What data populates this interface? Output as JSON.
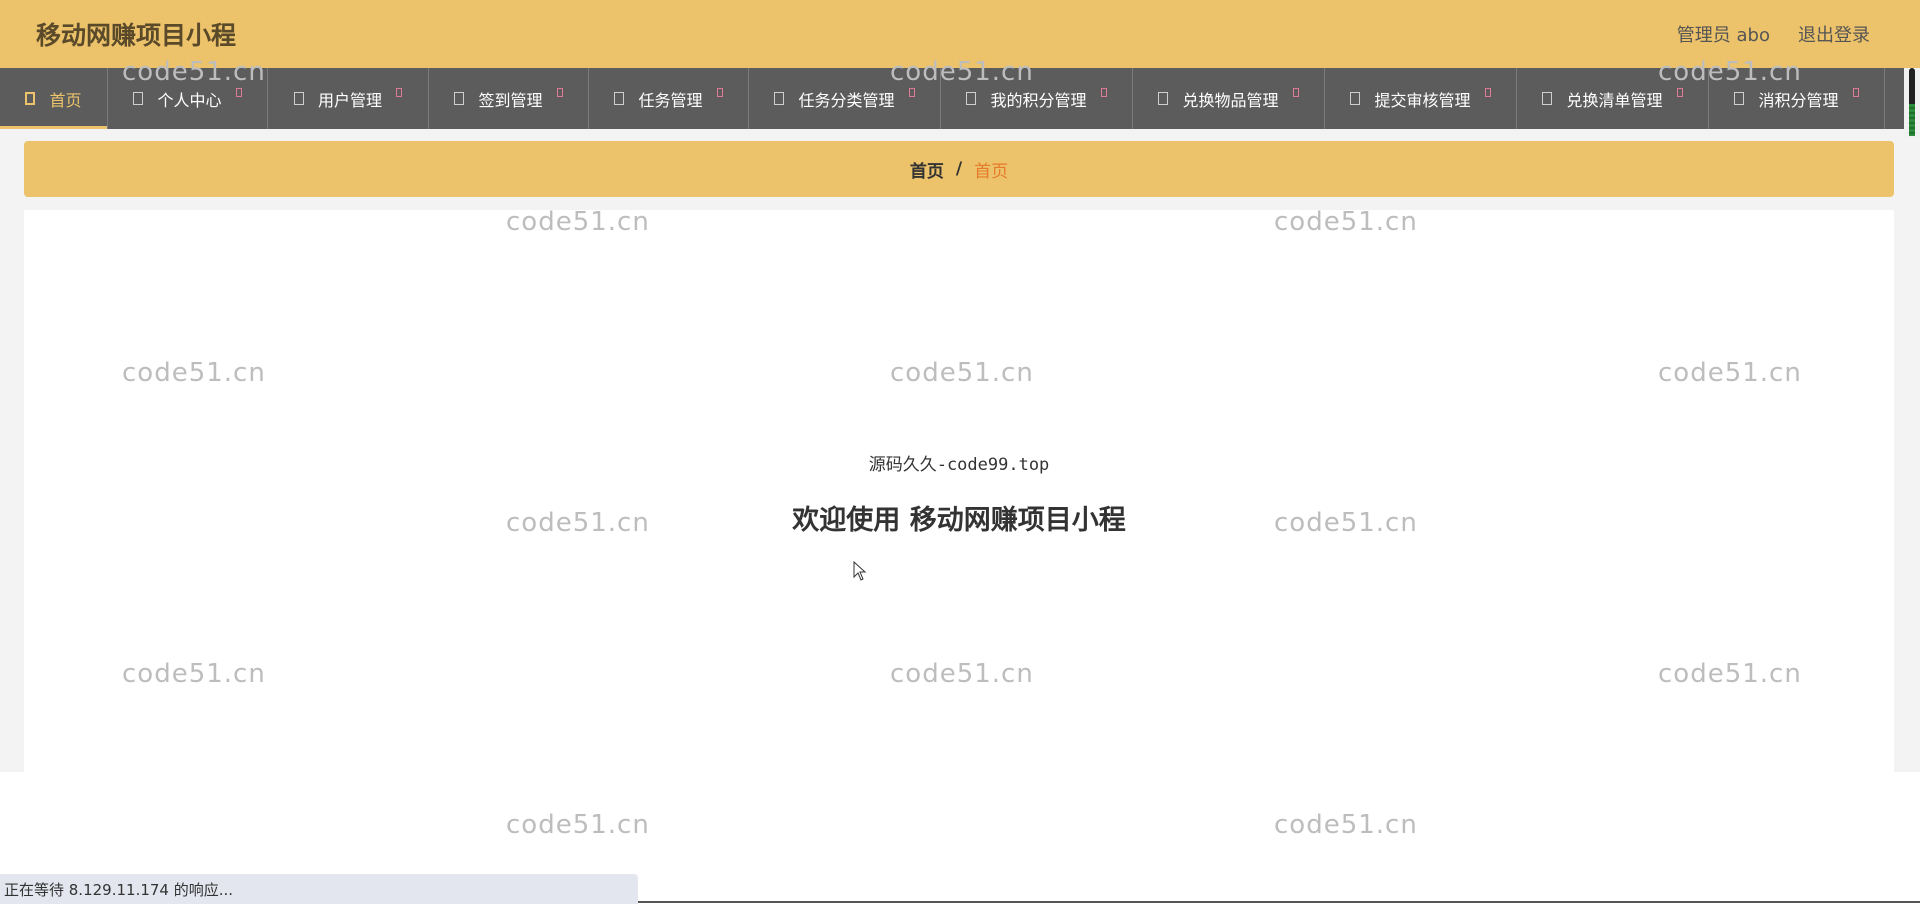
{
  "header": {
    "title": "移动网赚项目小程",
    "user_label": "管理员 abo",
    "logout_label": "退出登录"
  },
  "nav": {
    "items": [
      {
        "label": "首页",
        "active": true
      },
      {
        "label": "个人中心"
      },
      {
        "label": "用户管理"
      },
      {
        "label": "签到管理"
      },
      {
        "label": "任务管理"
      },
      {
        "label": "任务分类管理"
      },
      {
        "label": "我的积分管理"
      },
      {
        "label": "兑换物品管理"
      },
      {
        "label": "提交审核管理"
      },
      {
        "label": "兑换清单管理"
      },
      {
        "label": "消积分管理"
      }
    ]
  },
  "breadcrumb": {
    "home": "首页",
    "separator": "/",
    "current": "首页"
  },
  "content": {
    "subtitle": "源码久久-code99.top",
    "welcome": "欢迎使用 移动网赚项目小程"
  },
  "watermark": {
    "text": "code51.cn"
  },
  "statusbar": {
    "text": "正在等待 8.129.11.174 的响应..."
  },
  "colors": {
    "header_bg": "#ecc36a",
    "nav_bg": "#5c5c5c",
    "breadcrumb_current": "#e67a2a"
  }
}
